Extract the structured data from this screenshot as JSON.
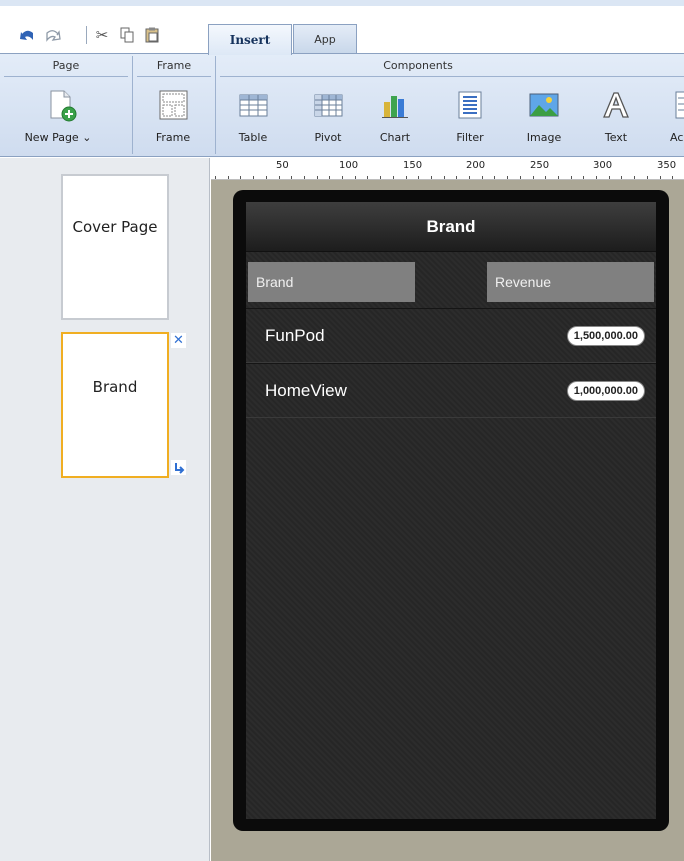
{
  "toolbar": {
    "quick_access": [
      {
        "name": "undo-icon",
        "glyph": "↶"
      },
      {
        "name": "redo-icon",
        "glyph": "↷"
      },
      {
        "name": "cut-icon",
        "glyph": "✂"
      },
      {
        "name": "copy-icon",
        "glyph": "⧉"
      },
      {
        "name": "paste-icon",
        "glyph": "📋"
      }
    ],
    "tabs": [
      {
        "label": "Insert",
        "active": true
      },
      {
        "label": "App",
        "active": false
      }
    ]
  },
  "ribbon": {
    "groups": {
      "page": "Page",
      "frame": "Frame",
      "components": "Components"
    },
    "buttons": {
      "new_page": "New Page ⌄",
      "frame": "Frame",
      "table": "Table",
      "pivot": "Pivot",
      "chart": "Chart",
      "filter": "Filter",
      "image": "Image",
      "text": "Text",
      "acc": "Acc"
    }
  },
  "pages": {
    "cover": "Cover Page",
    "brand": "Brand"
  },
  "ruler": {
    "labels": [
      "50",
      "100",
      "150",
      "200",
      "250",
      "300",
      "350"
    ]
  },
  "phone": {
    "title": "Brand",
    "columns": {
      "brand": "Brand",
      "revenue": "Revenue"
    },
    "rows": [
      {
        "label": "FunPod",
        "value": "1,500,000.00"
      },
      {
        "label": "HomeView",
        "value": "1,000,000.00"
      }
    ]
  },
  "colors": {
    "accent_selected": "#f0ae22",
    "ribbon_bg": "#dde8f6",
    "canvas_bg": "#aba796",
    "phone_bg": "#0b0b0b"
  }
}
